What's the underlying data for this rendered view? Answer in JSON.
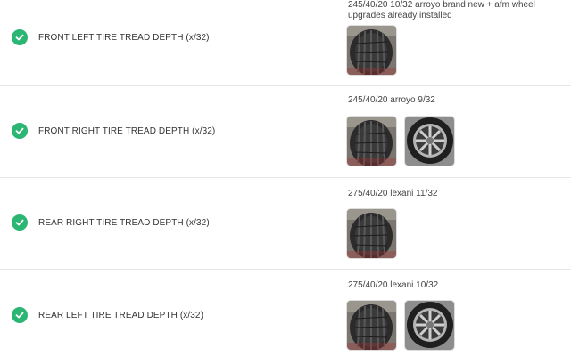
{
  "rows": [
    {
      "label": "FRONT LEFT TIRE TREAD DEPTH (x/32)",
      "status": "passed",
      "note": "245/40/20 10/32 arroyo brand new + afm wheel upgrades already installed",
      "photos": [
        "tire-tread-photo"
      ]
    },
    {
      "label": "FRONT RIGHT TIRE TREAD DEPTH (x/32)",
      "status": "passed",
      "note": "245/40/20 arroyo 9/32",
      "photos": [
        "tire-tread-photo",
        "wheel-photo"
      ]
    },
    {
      "label": "REAR RIGHT TIRE TREAD DEPTH (x/32)",
      "status": "passed",
      "note": "275/40/20 lexani 11/32",
      "photos": [
        "tire-tread-photo"
      ]
    },
    {
      "label": "REAR LEFT TIRE TREAD DEPTH (x/32)",
      "status": "passed",
      "note": "275/40/20 lexani 10/32",
      "photos": [
        "tire-tread-photo",
        "wheel-photo"
      ]
    }
  ],
  "colors": {
    "check": "#2bb673",
    "divider": "#e6e6e6"
  },
  "icons": {
    "status": "check-circle-icon"
  }
}
